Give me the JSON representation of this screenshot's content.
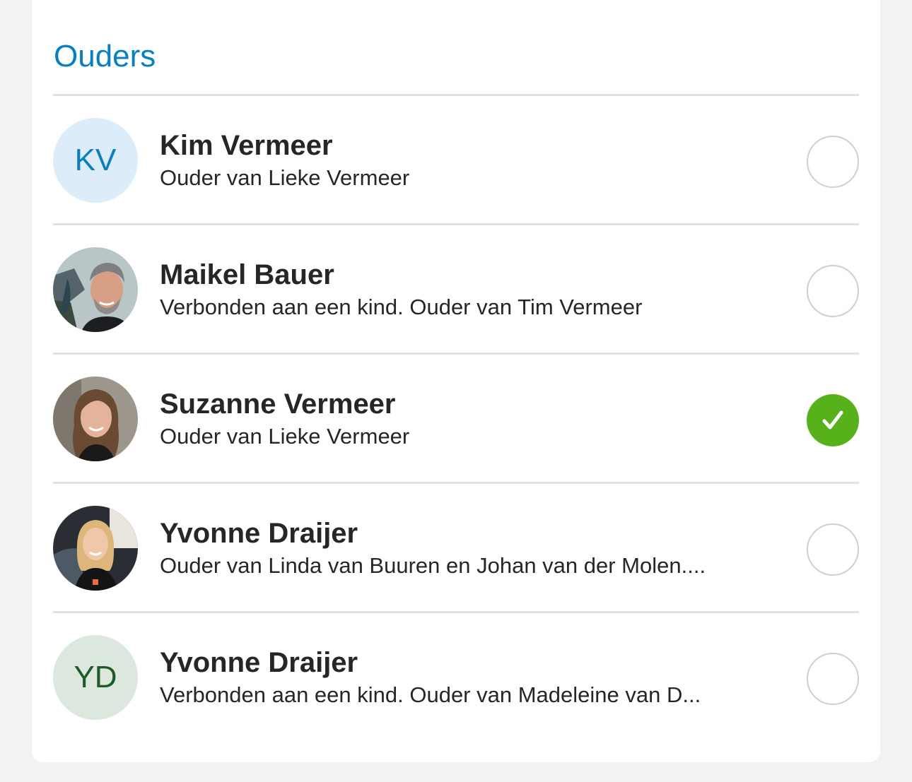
{
  "section": {
    "title": "Ouders"
  },
  "parents": [
    {
      "name": "Kim Vermeer",
      "subtitle": "Ouder van Lieke Vermeer",
      "avatar_type": "initials",
      "initials": "KV",
      "avatar_bg": "#dcedf9",
      "avatar_fg": "#0a7fc0",
      "selected": false
    },
    {
      "name": "Maikel Bauer",
      "subtitle": "Verbonden aan een kind. Ouder van Tim Vermeer",
      "avatar_type": "photo",
      "selected": false
    },
    {
      "name": "Suzanne Vermeer",
      "subtitle": "Ouder van Lieke Vermeer",
      "avatar_type": "photo",
      "selected": true
    },
    {
      "name": "Yvonne Draijer",
      "subtitle": "Ouder van Linda van Buuren en Johan van der Molen....",
      "avatar_type": "photo",
      "selected": false
    },
    {
      "name": "Yvonne Draijer",
      "subtitle": "Verbonden aan een kind. Ouder van Madeleine van D...",
      "avatar_type": "initials",
      "initials": "YD",
      "avatar_bg": "#dce7de",
      "avatar_fg": "#1f5a2a",
      "selected": false
    }
  ],
  "colors": {
    "title": "#0a7fc0",
    "check_green": "#57b11a",
    "divider": "#e1e1e1",
    "radio_border": "#cfcfcf"
  }
}
